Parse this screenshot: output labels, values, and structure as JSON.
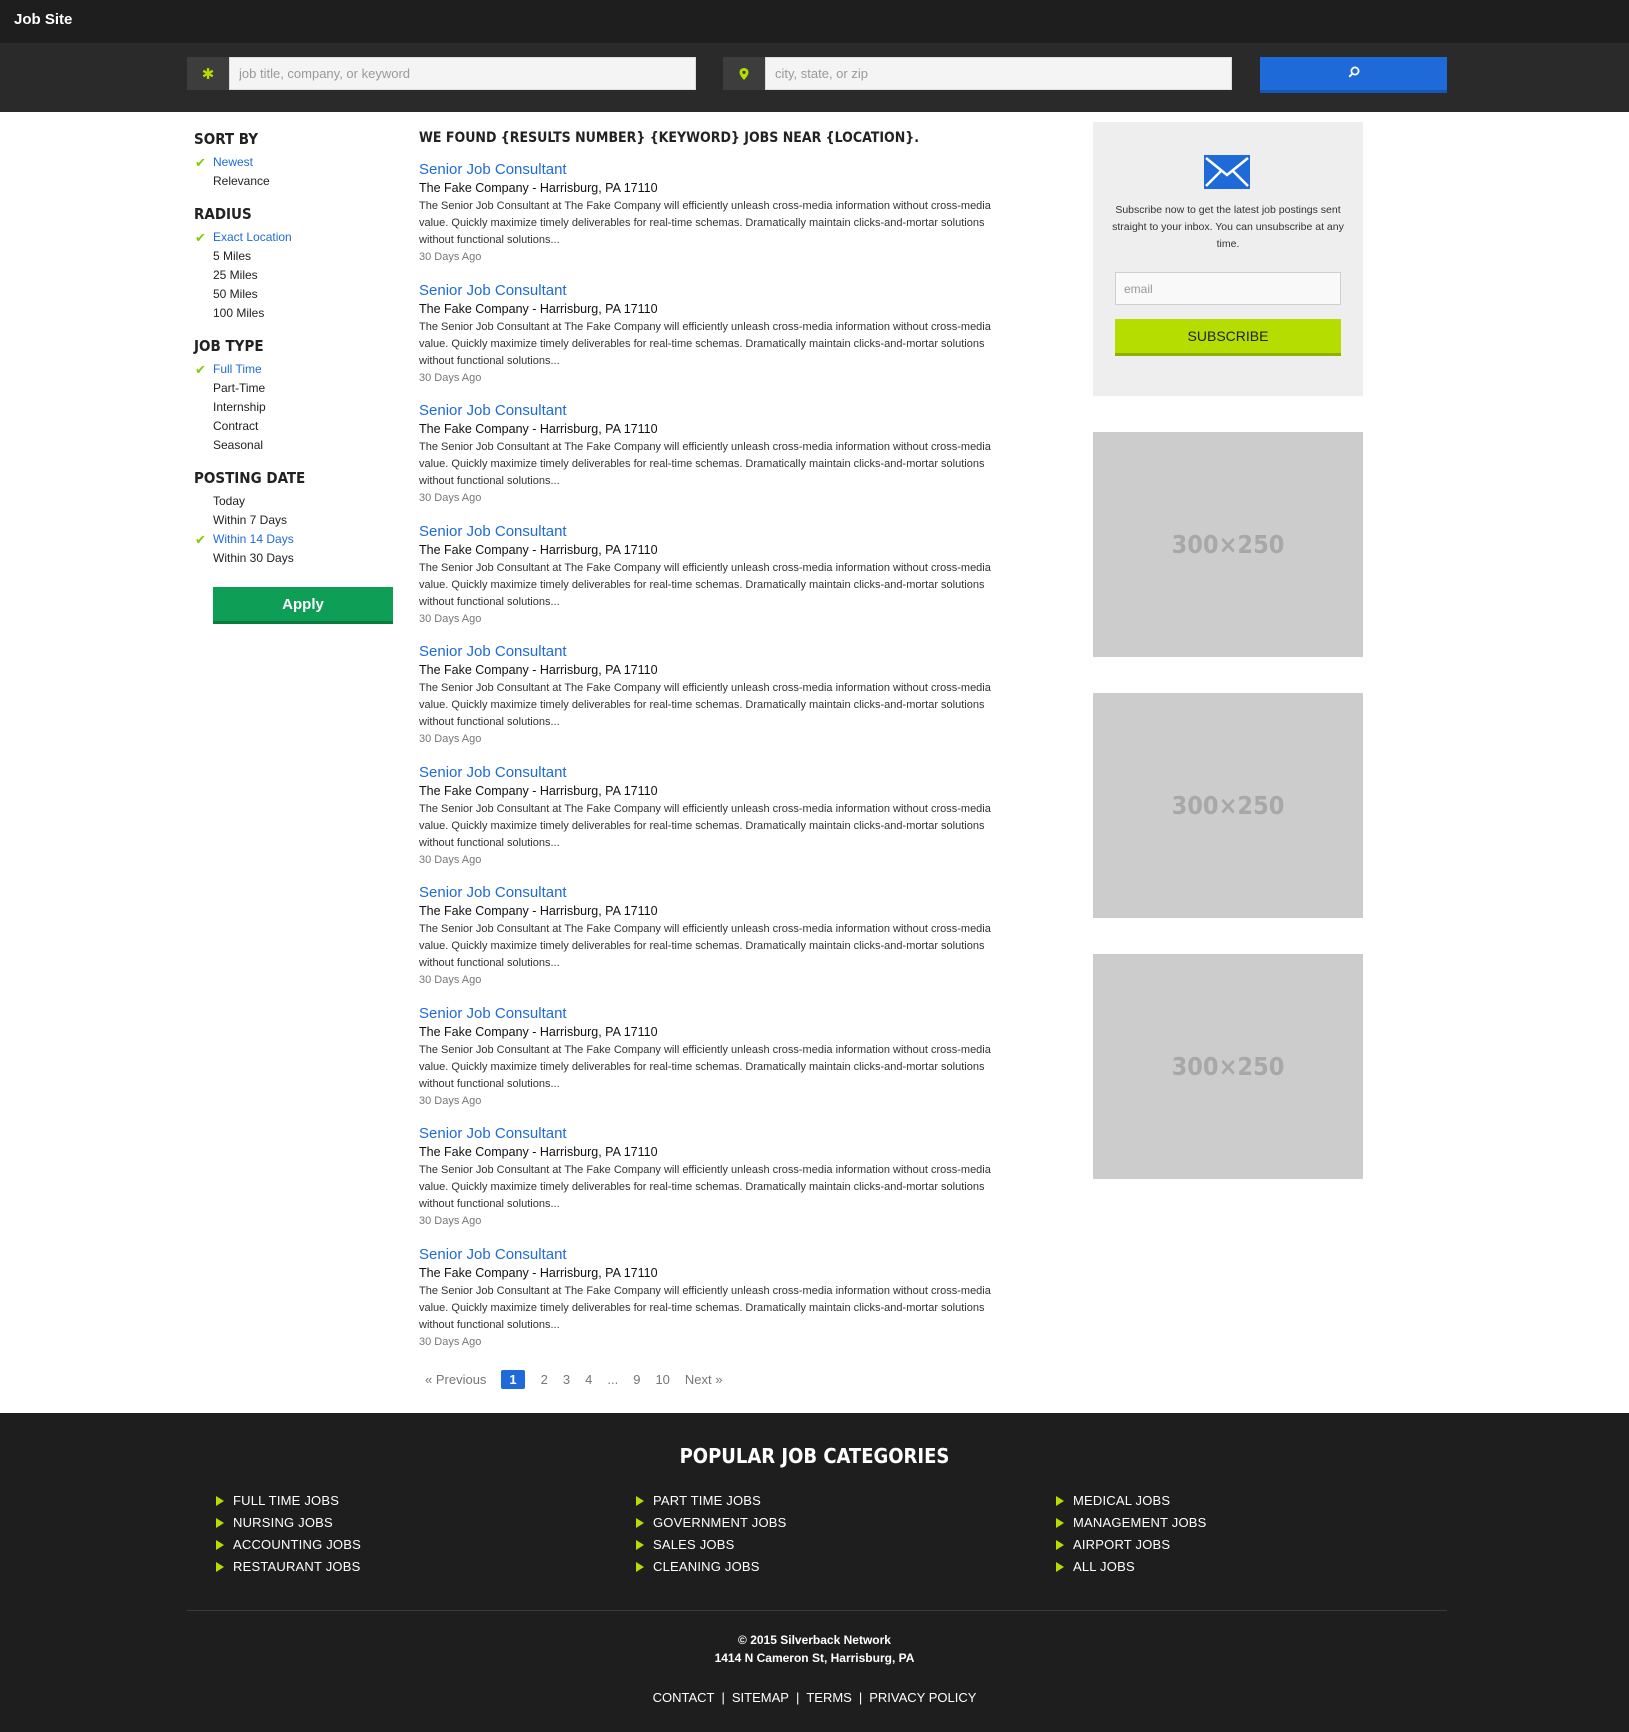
{
  "header": {
    "brand": "Job Site"
  },
  "search": {
    "keyword_icon": "asterisk-icon",
    "keyword_placeholder": "job title, company, or keyword",
    "location_icon": "map-pin-icon",
    "location_placeholder": "city, state, or zip",
    "button_icon": "search-icon"
  },
  "filters": {
    "sort_by": {
      "heading": "SORT BY",
      "items": [
        {
          "label": "Newest",
          "active": true
        },
        {
          "label": "Relevance",
          "active": false
        }
      ]
    },
    "radius": {
      "heading": "RADIUS",
      "items": [
        {
          "label": "Exact Location",
          "active": true
        },
        {
          "label": "5 Miles",
          "active": false
        },
        {
          "label": "25 Miles",
          "active": false
        },
        {
          "label": "50 Miles",
          "active": false
        },
        {
          "label": "100 Miles",
          "active": false
        }
      ]
    },
    "job_type": {
      "heading": "JOB TYPE",
      "items": [
        {
          "label": "Full Time",
          "active": true
        },
        {
          "label": "Part-Time",
          "active": false
        },
        {
          "label": "Internship",
          "active": false
        },
        {
          "label": "Contract",
          "active": false
        },
        {
          "label": "Seasonal",
          "active": false
        }
      ]
    },
    "posting_date": {
      "heading": "POSTING DATE",
      "items": [
        {
          "label": "Today",
          "active": false
        },
        {
          "label": "Within 7 Days",
          "active": false
        },
        {
          "label": "Within 14 Days",
          "active": true
        },
        {
          "label": "Within 30 Days",
          "active": false
        }
      ]
    },
    "check_icon": "checkmark-icon",
    "apply_label": "Apply"
  },
  "results": {
    "heading": "WE FOUND {RESULTS NUMBER} {KEYWORD} JOBS NEAR {LOCATION}.",
    "jobs": [
      {
        "title": "Senior Job Consultant",
        "company": "The Fake Company - Harrisburg, PA 17110",
        "description": "The Senior Job Consultant at The Fake Company will efficiently unleash cross-media information without cross-media value. Quickly maximize timely deliverables for real-time schemas. Dramatically maintain clicks-and-mortar solutions without functional solutions...",
        "posted": "30 Days Ago"
      },
      {
        "title": "Senior Job Consultant",
        "company": "The Fake Company - Harrisburg, PA 17110",
        "description": "The Senior Job Consultant at The Fake Company will efficiently unleash cross-media information without cross-media value. Quickly maximize timely deliverables for real-time schemas. Dramatically maintain clicks-and-mortar solutions without functional solutions...",
        "posted": "30 Days Ago"
      },
      {
        "title": "Senior Job Consultant",
        "company": "The Fake Company - Harrisburg, PA 17110",
        "description": "The Senior Job Consultant at The Fake Company will efficiently unleash cross-media information without cross-media value. Quickly maximize timely deliverables for real-time schemas. Dramatically maintain clicks-and-mortar solutions without functional solutions...",
        "posted": "30 Days Ago"
      },
      {
        "title": "Senior Job Consultant",
        "company": "The Fake Company - Harrisburg, PA 17110",
        "description": "The Senior Job Consultant at The Fake Company will efficiently unleash cross-media information without cross-media value. Quickly maximize timely deliverables for real-time schemas. Dramatically maintain clicks-and-mortar solutions without functional solutions...",
        "posted": "30 Days Ago"
      },
      {
        "title": "Senior Job Consultant",
        "company": "The Fake Company - Harrisburg, PA 17110",
        "description": "The Senior Job Consultant at The Fake Company will efficiently unleash cross-media information without cross-media value. Quickly maximize timely deliverables for real-time schemas. Dramatically maintain clicks-and-mortar solutions without functional solutions...",
        "posted": "30 Days Ago"
      },
      {
        "title": "Senior Job Consultant",
        "company": "The Fake Company - Harrisburg, PA 17110",
        "description": "The Senior Job Consultant at The Fake Company will efficiently unleash cross-media information without cross-media value. Quickly maximize timely deliverables for real-time schemas. Dramatically maintain clicks-and-mortar solutions without functional solutions...",
        "posted": "30 Days Ago"
      },
      {
        "title": "Senior Job Consultant",
        "company": "The Fake Company - Harrisburg, PA 17110",
        "description": "The Senior Job Consultant at The Fake Company will efficiently unleash cross-media information without cross-media value. Quickly maximize timely deliverables for real-time schemas. Dramatically maintain clicks-and-mortar solutions without functional solutions...",
        "posted": "30 Days Ago"
      },
      {
        "title": "Senior Job Consultant",
        "company": "The Fake Company - Harrisburg, PA 17110",
        "description": "The Senior Job Consultant at The Fake Company will efficiently unleash cross-media information without cross-media value. Quickly maximize timely deliverables for real-time schemas. Dramatically maintain clicks-and-mortar solutions without functional solutions...",
        "posted": "30 Days Ago"
      },
      {
        "title": "Senior Job Consultant",
        "company": "The Fake Company - Harrisburg, PA 17110",
        "description": "The Senior Job Consultant at The Fake Company will efficiently unleash cross-media information without cross-media value. Quickly maximize timely deliverables for real-time schemas. Dramatically maintain clicks-and-mortar solutions without functional solutions...",
        "posted": "30 Days Ago"
      },
      {
        "title": "Senior Job Consultant",
        "company": "The Fake Company - Harrisburg, PA 17110",
        "description": "The Senior Job Consultant at The Fake Company will efficiently unleash cross-media information without cross-media value. Quickly maximize timely deliverables for real-time schemas. Dramatically maintain clicks-and-mortar solutions without functional solutions...",
        "posted": "30 Days Ago"
      }
    ]
  },
  "pagination": {
    "previous": "« Previous",
    "current": "1",
    "pages": [
      "2",
      "3",
      "4",
      "...",
      "9",
      "10"
    ],
    "next": "Next »"
  },
  "subscribe": {
    "icon": "envelope-icon",
    "text": "Subscribe now to get the latest job postings sent straight to your inbox. You can unsubscribe at any time.",
    "email_placeholder": "email",
    "button_label": "SUBSCRIBE"
  },
  "ads": [
    "300×250",
    "300×250",
    "300×250"
  ],
  "footer": {
    "categories_title": "POPULAR JOB CATEGORIES",
    "columns": [
      [
        "FULL TIME JOBS",
        "NURSING JOBS",
        "ACCOUNTING JOBS",
        "RESTAURANT JOBS"
      ],
      [
        "PART TIME JOBS",
        "GOVERNMENT JOBS",
        "SALES JOBS",
        "CLEANING JOBS"
      ],
      [
        "MEDICAL JOBS",
        "MANAGEMENT JOBS",
        "AIRPORT JOBS",
        "ALL JOBS"
      ]
    ],
    "arrow_icon": "triangle-right-icon",
    "copyright": "© 2015 Silverback Network",
    "address": "1414 N Cameron St, Harrisburg, PA",
    "links": [
      "CONTACT",
      "SITEMAP",
      "TERMS",
      "PRIVACY POLICY"
    ]
  },
  "colors": {
    "header_bg": "#1e1e1e",
    "search_bg": "#2a2a2a",
    "accent_blue": "#1f6ad9",
    "accent_green": "#b5de00",
    "apply_green": "#0f9e55",
    "ad_gray": "#cccccc"
  }
}
